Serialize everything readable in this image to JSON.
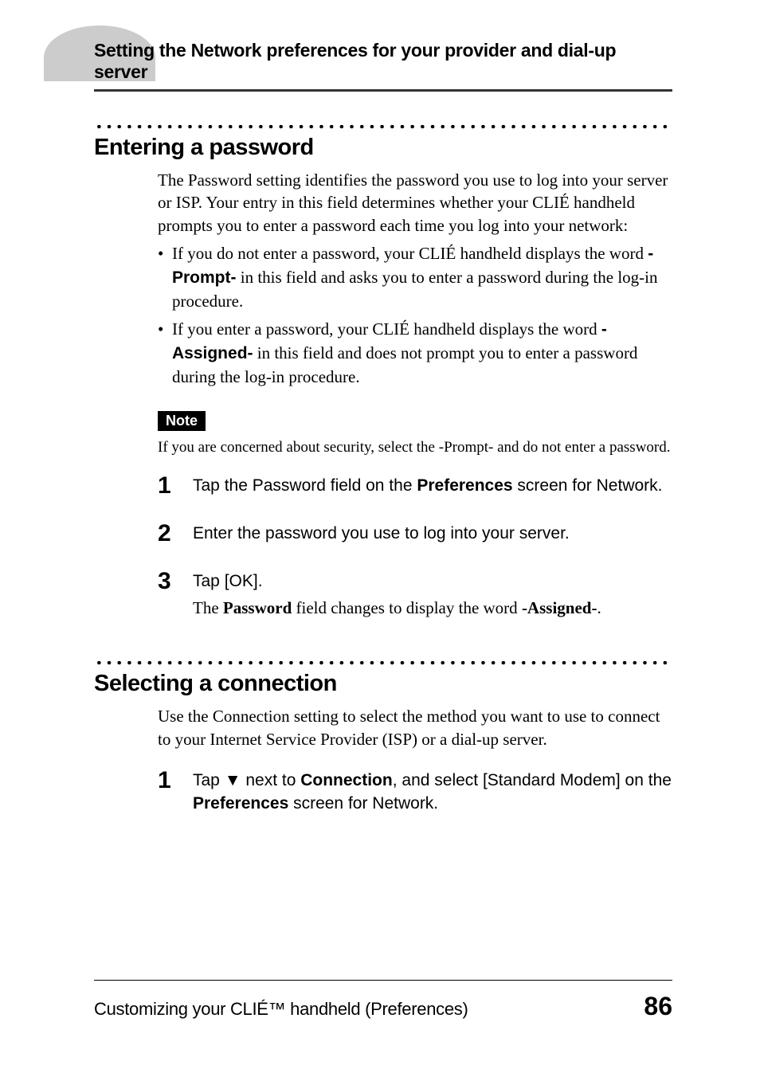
{
  "header": {
    "title": "Setting the Network preferences for your provider and dial-up server"
  },
  "sections": {
    "s1": {
      "heading": "Entering a password",
      "intro": "The Password setting identifies the password you use to log into your server or ISP. Your entry in this field determines whether your CLIÉ handheld prompts you to enter a password each time you log into your network:",
      "bullets": {
        "b1": {
          "pre": "If you do not enter a password, your CLIÉ handheld displays the word ",
          "bold": "-Prompt-",
          "post": " in this field and asks you to enter a password during the log-in procedure."
        },
        "b2": {
          "pre": "If you enter a password, your CLIÉ handheld displays the word ",
          "bold": "-Assigned-",
          "post": " in this field and does not prompt you to enter a password during the log-in procedure."
        }
      },
      "note_label": "Note",
      "note_text": "If you are concerned about security, select the -Prompt- and do not enter a password.",
      "steps": {
        "st1": {
          "num": "1",
          "t_pre": "Tap the Password field on the ",
          "t_bold1": "Preferences",
          "t_post": " screen for Network."
        },
        "st2": {
          "num": "2",
          "t": "Enter the password you use to log into your server."
        },
        "st3": {
          "num": "3",
          "t": "Tap [OK].",
          "sub_pre": "The ",
          "sub_bold1": "Password",
          "sub_mid": " field changes to display the word ",
          "sub_bold2": "-Assigned-",
          "sub_post": "."
        }
      }
    },
    "s2": {
      "heading": "Selecting a connection",
      "intro": "Use the Connection setting to select the method you want to use to connect to your Internet Service Provider (ISP) or a dial-up server.",
      "steps": {
        "st1": {
          "num": "1",
          "t_pre": "Tap ",
          "tri": "▼",
          "t_mid1": " next to ",
          "t_bold1": "Connection",
          "t_mid2": ", and select [Standard Modem] on the ",
          "t_bold2": "Preferences",
          "t_post": " screen for Network."
        }
      }
    }
  },
  "footer": {
    "text": "Customizing your CLIÉ™ handheld (Preferences)",
    "page": "86"
  }
}
